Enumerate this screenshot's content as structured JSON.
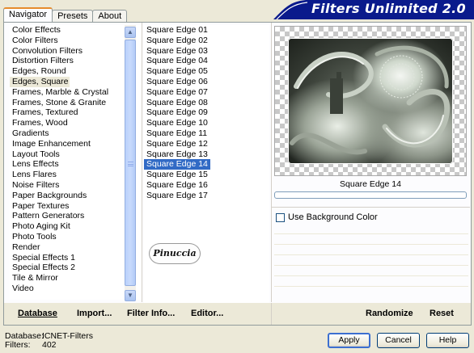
{
  "banner": {
    "title": "Filters Unlimited 2.0"
  },
  "tabs": [
    {
      "label": "Navigator",
      "active": true
    },
    {
      "label": "Presets",
      "active": false
    },
    {
      "label": "About",
      "active": false
    }
  ],
  "categories": [
    "Color Effects",
    "Color Filters",
    "Convolution Filters",
    "Distortion Filters",
    "Edges, Round",
    "Edges, Square",
    "Frames, Marble & Crystal",
    "Frames, Stone & Granite",
    "Frames, Textured",
    "Frames, Wood",
    "Gradients",
    "Image Enhancement",
    "Layout Tools",
    "Lens Effects",
    "Lens Flares",
    "Noise Filters",
    "Paper Backgrounds",
    "Paper Textures",
    "Pattern Generators",
    "Photo Aging Kit",
    "Photo Tools",
    "Render",
    "Special Effects 1",
    "Special Effects 2",
    "Tile & Mirror",
    "Video"
  ],
  "selected_category": "Edges, Square",
  "filters": [
    "Square Edge 01",
    "Square Edge 02",
    "Square Edge 03",
    "Square Edge 04",
    "Square Edge 05",
    "Square Edge 06",
    "Square Edge 07",
    "Square Edge 08",
    "Square Edge 09",
    "Square Edge 10",
    "Square Edge 11",
    "Square Edge 12",
    "Square Edge 13",
    "Square Edge 14",
    "Square Edge 15",
    "Square Edge 16",
    "Square Edge 17"
  ],
  "selected_filter": "Square Edge 14",
  "logo_text": "Pinuccia",
  "preview": {
    "filter_name": "Square Edge 14"
  },
  "options": {
    "use_background_color": "Use Background Color",
    "checked": false
  },
  "toolbar": {
    "database": "Database",
    "import": "Import...",
    "filter_info": "Filter Info...",
    "editor": "Editor...",
    "randomize": "Randomize",
    "reset": "Reset"
  },
  "info": {
    "database_label": "Database:",
    "database_value": "ICNET-Filters",
    "filters_label": "Filters:",
    "filters_value": "402"
  },
  "buttons": {
    "apply": "Apply",
    "cancel": "Cancel",
    "help": "Help"
  },
  "colors": {
    "banner_bg": "#0a1a8c",
    "selection": "#316ac5",
    "tab_accent": "#e68b2c"
  }
}
